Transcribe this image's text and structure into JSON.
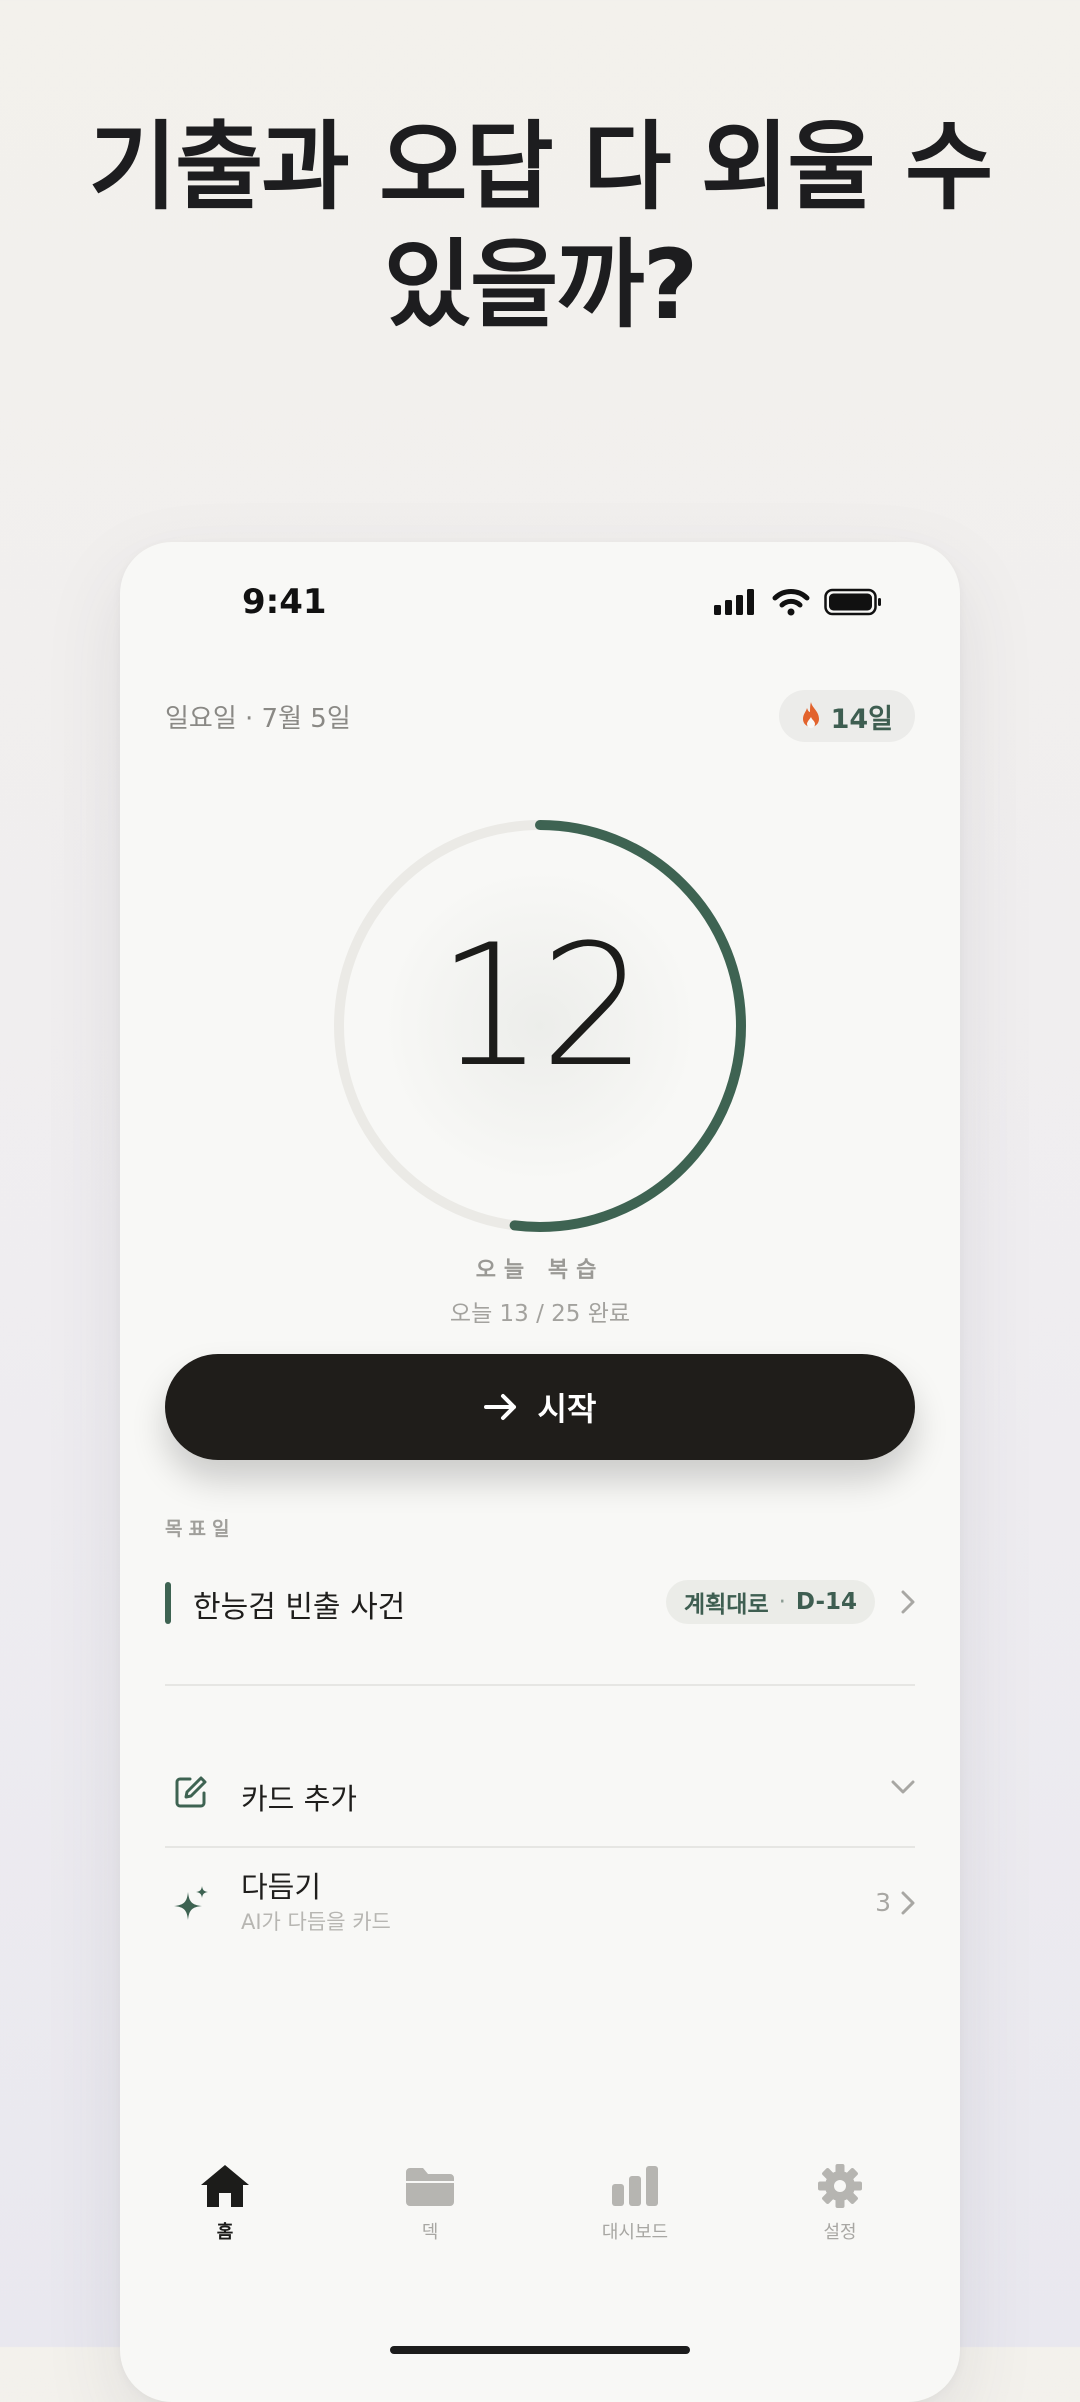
{
  "headline": {
    "line1": "기출과 오답 다 외울 수",
    "line2": "있을까?"
  },
  "status_bar": {
    "time": "9:41"
  },
  "header": {
    "date": "일요일  ·  7월 5일",
    "streak": "14일",
    "streak_icon": "flame-icon"
  },
  "review": {
    "count": "12",
    "label": "오늘 복습",
    "progress_text": "오늘 13 / 25 완료",
    "completed": 13,
    "total": 25
  },
  "start_button": {
    "label": "시작",
    "icon": "arrow-right-icon"
  },
  "goal_section": {
    "label": "목표일",
    "title": "한능검 빈출 사건",
    "status": "계획대로",
    "dday": "D-14"
  },
  "actions": {
    "add_card": {
      "label": "카드 추가",
      "icon": "edit-icon"
    },
    "refine": {
      "title": "다듬기",
      "subtitle": "AI가 다듬을 카드",
      "count": "3",
      "icon": "sparkle-icon"
    }
  },
  "tabbar": [
    {
      "label": "홈",
      "icon": "home-icon",
      "active": true
    },
    {
      "label": "덱",
      "icon": "folder-icon",
      "active": false
    },
    {
      "label": "대시보드",
      "icon": "bar-chart-icon",
      "active": false
    },
    {
      "label": "설정",
      "icon": "gear-icon",
      "active": false
    }
  ],
  "colors": {
    "accent": "#3e6352",
    "button": "#1f1d1a",
    "ring_track": "#ebeae6",
    "streak_flame": "#e2632d"
  }
}
